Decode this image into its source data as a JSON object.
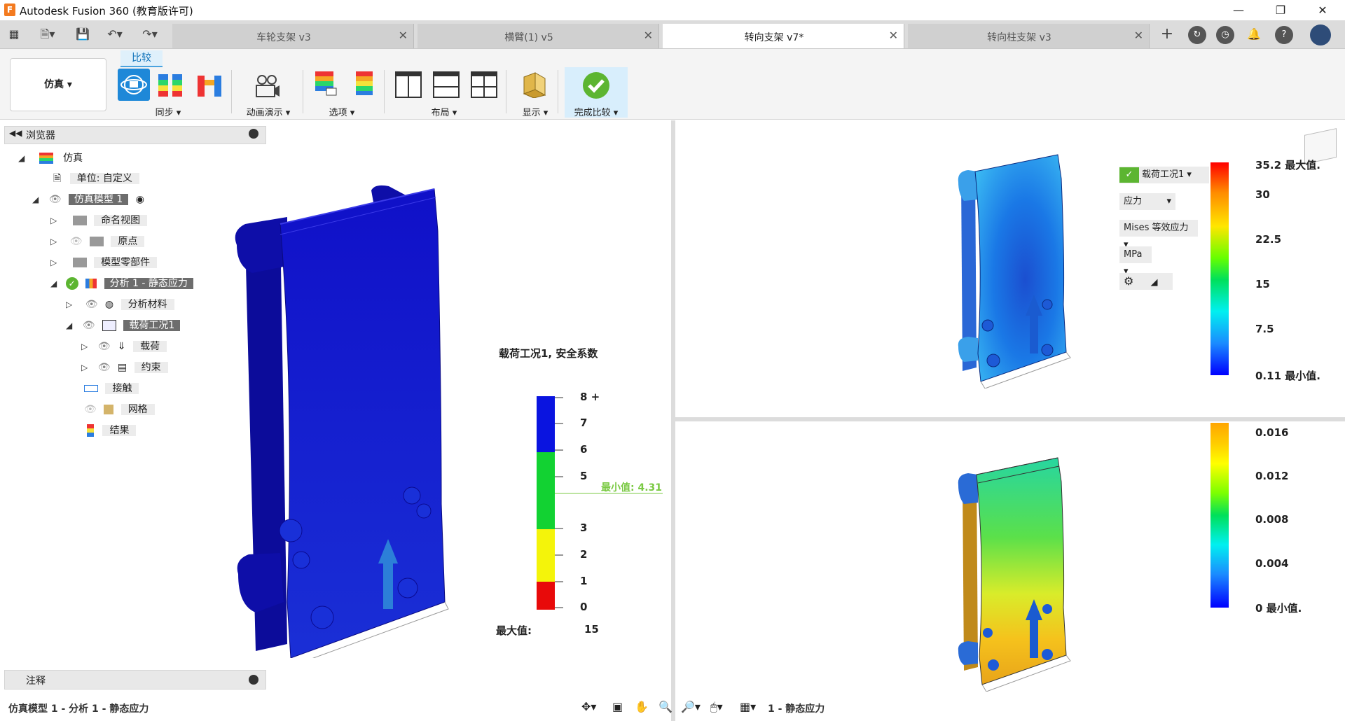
{
  "window": {
    "title": "Autodesk Fusion 360 (教育版许可)",
    "logo": "F"
  },
  "tabs": [
    {
      "label": "车轮支架 v3"
    },
    {
      "label": "横臂(1) v5"
    },
    {
      "label": "转向支架 v7*"
    },
    {
      "label": "转向柱支架 v3"
    }
  ],
  "ribbon": {
    "workspace": "仿真 ▾",
    "active_tab": "比较",
    "groups": {
      "sync": "同步 ▾",
      "animate": "动画演示 ▾",
      "options": "选项 ▾",
      "layout": "布局 ▾",
      "display": "显示 ▾",
      "finish": "完成比较 ▾"
    }
  },
  "browser": {
    "title": "浏览器",
    "items": [
      {
        "label": "仿真"
      },
      {
        "label": "单位: 自定义"
      },
      {
        "label": "仿真模型 1"
      },
      {
        "label": "命名视图"
      },
      {
        "label": "原点"
      },
      {
        "label": "模型零部件"
      },
      {
        "label": "分析 1 - 静态应力"
      },
      {
        "label": "分析材料"
      },
      {
        "label": "载荷工况1"
      },
      {
        "label": "载荷"
      },
      {
        "label": "约束"
      },
      {
        "label": "接触"
      },
      {
        "label": "网格"
      },
      {
        "label": "结果"
      }
    ]
  },
  "notes": {
    "title": "注释"
  },
  "status": {
    "text": "仿真模型 1 - 分析 1 - 静态应力",
    "nav_text": "1 - 静态应力"
  },
  "left_view": {
    "legend_title": "载荷工况1, 安全系数",
    "ticks": [
      "8 +",
      "7",
      "6",
      "5",
      "3",
      "2",
      "1",
      "0"
    ],
    "min_label": "最小值: 4.31",
    "max_label": "最大值:",
    "max_value": "15"
  },
  "right_top": {
    "loadcase": "载荷工况1 ▾",
    "result_type": "应力",
    "component": "Mises 等效应力 ▾",
    "unit": "MPa ▾",
    "ticks": [
      "35.2 最大值.",
      "30",
      "22.5",
      "15",
      "7.5",
      "0.11 最小值."
    ]
  },
  "right_bottom": {
    "ticks": [
      "0.016",
      "0.012",
      "0.008",
      "0.004",
      "0 最小值."
    ]
  },
  "colors": {
    "accent": "#0a6fb8",
    "success": "#5cb531",
    "highlight": "#6d6d6d"
  }
}
